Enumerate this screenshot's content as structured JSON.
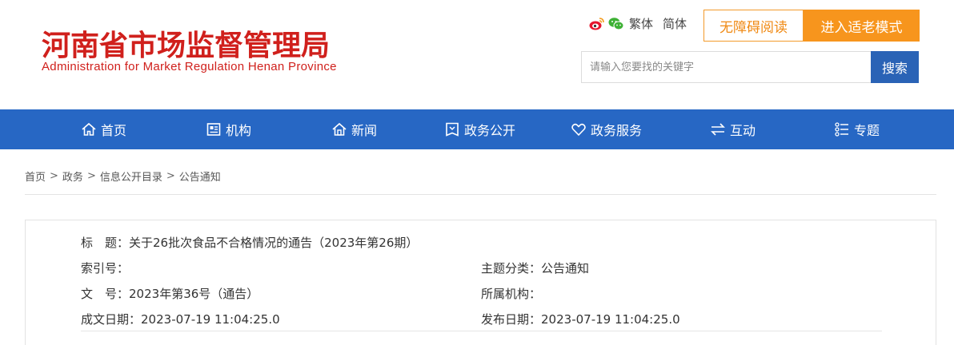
{
  "header": {
    "logo_cn": "河南省市场监督管理局",
    "logo_en": "Administration for Market Regulation Henan Province",
    "lang_traditional": "繁体",
    "lang_simplified": "简体",
    "accessibility_label": "无障碍阅读",
    "elder_mode_label": "进入适老模式",
    "search_placeholder": "请输入您要找的关键字",
    "search_label": "搜索"
  },
  "colors": {
    "brand_red": "#d0201c",
    "nav_blue": "#2767c4",
    "accent_orange": "#f7951d",
    "search_blue": "#2a63b6"
  },
  "nav": {
    "items": [
      {
        "label": "首页",
        "icon": "home-icon"
      },
      {
        "label": "机构",
        "icon": "org-icon"
      },
      {
        "label": "新闻",
        "icon": "news-icon"
      },
      {
        "label": "政务公开",
        "icon": "gov-open-icon"
      },
      {
        "label": "政务服务",
        "icon": "heart-icon"
      },
      {
        "label": "互动",
        "icon": "interact-icon"
      },
      {
        "label": "专题",
        "icon": "topic-icon"
      }
    ]
  },
  "breadcrumb": {
    "items": [
      "首页",
      "政务",
      "信息公开目录",
      "公告通知"
    ],
    "separator": ">"
  },
  "info": {
    "title_label": "标　题：",
    "title_value": "关于26批次食品不合格情况的通告（2023年第26期）",
    "index_label": "索引号：",
    "index_value": "",
    "topic_label": "主题分类：",
    "topic_value": "公告通知",
    "docno_label": "文　号：",
    "docno_value": "2023年第36号（通告）",
    "org_label": "所属机构：",
    "org_value": "",
    "written_label": "成文日期：",
    "written_value": "2023-07-19 11:04:25.0",
    "published_label": "发布日期：",
    "published_value": "2023-07-19 11:04:25.0"
  }
}
